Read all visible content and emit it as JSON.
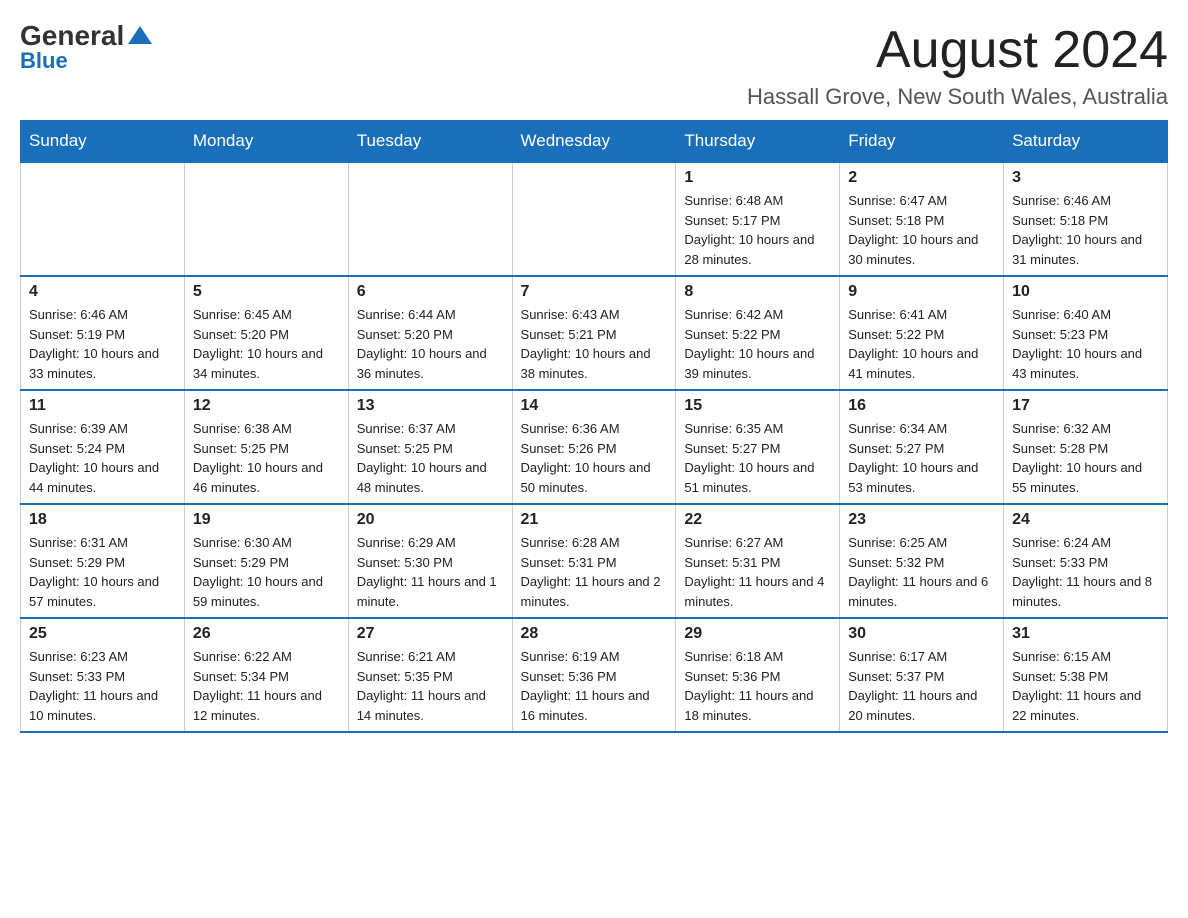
{
  "header": {
    "logo_general": "General",
    "logo_blue": "Blue",
    "month_title": "August 2024",
    "location": "Hassall Grove, New South Wales, Australia"
  },
  "weekdays": [
    "Sunday",
    "Monday",
    "Tuesday",
    "Wednesday",
    "Thursday",
    "Friday",
    "Saturday"
  ],
  "weeks": [
    [
      {
        "day": "",
        "info": ""
      },
      {
        "day": "",
        "info": ""
      },
      {
        "day": "",
        "info": ""
      },
      {
        "day": "",
        "info": ""
      },
      {
        "day": "1",
        "info": "Sunrise: 6:48 AM\nSunset: 5:17 PM\nDaylight: 10 hours and 28 minutes."
      },
      {
        "day": "2",
        "info": "Sunrise: 6:47 AM\nSunset: 5:18 PM\nDaylight: 10 hours and 30 minutes."
      },
      {
        "day": "3",
        "info": "Sunrise: 6:46 AM\nSunset: 5:18 PM\nDaylight: 10 hours and 31 minutes."
      }
    ],
    [
      {
        "day": "4",
        "info": "Sunrise: 6:46 AM\nSunset: 5:19 PM\nDaylight: 10 hours and 33 minutes."
      },
      {
        "day": "5",
        "info": "Sunrise: 6:45 AM\nSunset: 5:20 PM\nDaylight: 10 hours and 34 minutes."
      },
      {
        "day": "6",
        "info": "Sunrise: 6:44 AM\nSunset: 5:20 PM\nDaylight: 10 hours and 36 minutes."
      },
      {
        "day": "7",
        "info": "Sunrise: 6:43 AM\nSunset: 5:21 PM\nDaylight: 10 hours and 38 minutes."
      },
      {
        "day": "8",
        "info": "Sunrise: 6:42 AM\nSunset: 5:22 PM\nDaylight: 10 hours and 39 minutes."
      },
      {
        "day": "9",
        "info": "Sunrise: 6:41 AM\nSunset: 5:22 PM\nDaylight: 10 hours and 41 minutes."
      },
      {
        "day": "10",
        "info": "Sunrise: 6:40 AM\nSunset: 5:23 PM\nDaylight: 10 hours and 43 minutes."
      }
    ],
    [
      {
        "day": "11",
        "info": "Sunrise: 6:39 AM\nSunset: 5:24 PM\nDaylight: 10 hours and 44 minutes."
      },
      {
        "day": "12",
        "info": "Sunrise: 6:38 AM\nSunset: 5:25 PM\nDaylight: 10 hours and 46 minutes."
      },
      {
        "day": "13",
        "info": "Sunrise: 6:37 AM\nSunset: 5:25 PM\nDaylight: 10 hours and 48 minutes."
      },
      {
        "day": "14",
        "info": "Sunrise: 6:36 AM\nSunset: 5:26 PM\nDaylight: 10 hours and 50 minutes."
      },
      {
        "day": "15",
        "info": "Sunrise: 6:35 AM\nSunset: 5:27 PM\nDaylight: 10 hours and 51 minutes."
      },
      {
        "day": "16",
        "info": "Sunrise: 6:34 AM\nSunset: 5:27 PM\nDaylight: 10 hours and 53 minutes."
      },
      {
        "day": "17",
        "info": "Sunrise: 6:32 AM\nSunset: 5:28 PM\nDaylight: 10 hours and 55 minutes."
      }
    ],
    [
      {
        "day": "18",
        "info": "Sunrise: 6:31 AM\nSunset: 5:29 PM\nDaylight: 10 hours and 57 minutes."
      },
      {
        "day": "19",
        "info": "Sunrise: 6:30 AM\nSunset: 5:29 PM\nDaylight: 10 hours and 59 minutes."
      },
      {
        "day": "20",
        "info": "Sunrise: 6:29 AM\nSunset: 5:30 PM\nDaylight: 11 hours and 1 minute."
      },
      {
        "day": "21",
        "info": "Sunrise: 6:28 AM\nSunset: 5:31 PM\nDaylight: 11 hours and 2 minutes."
      },
      {
        "day": "22",
        "info": "Sunrise: 6:27 AM\nSunset: 5:31 PM\nDaylight: 11 hours and 4 minutes."
      },
      {
        "day": "23",
        "info": "Sunrise: 6:25 AM\nSunset: 5:32 PM\nDaylight: 11 hours and 6 minutes."
      },
      {
        "day": "24",
        "info": "Sunrise: 6:24 AM\nSunset: 5:33 PM\nDaylight: 11 hours and 8 minutes."
      }
    ],
    [
      {
        "day": "25",
        "info": "Sunrise: 6:23 AM\nSunset: 5:33 PM\nDaylight: 11 hours and 10 minutes."
      },
      {
        "day": "26",
        "info": "Sunrise: 6:22 AM\nSunset: 5:34 PM\nDaylight: 11 hours and 12 minutes."
      },
      {
        "day": "27",
        "info": "Sunrise: 6:21 AM\nSunset: 5:35 PM\nDaylight: 11 hours and 14 minutes."
      },
      {
        "day": "28",
        "info": "Sunrise: 6:19 AM\nSunset: 5:36 PM\nDaylight: 11 hours and 16 minutes."
      },
      {
        "day": "29",
        "info": "Sunrise: 6:18 AM\nSunset: 5:36 PM\nDaylight: 11 hours and 18 minutes."
      },
      {
        "day": "30",
        "info": "Sunrise: 6:17 AM\nSunset: 5:37 PM\nDaylight: 11 hours and 20 minutes."
      },
      {
        "day": "31",
        "info": "Sunrise: 6:15 AM\nSunset: 5:38 PM\nDaylight: 11 hours and 22 minutes."
      }
    ]
  ]
}
